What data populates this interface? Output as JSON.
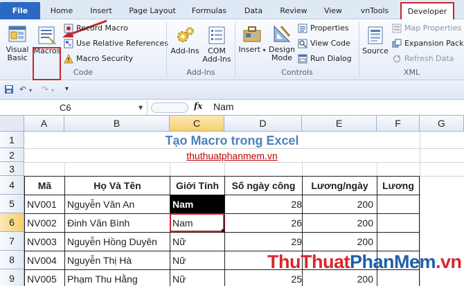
{
  "ribbon_tabs": {
    "file": "File",
    "home": "Home",
    "insert": "Insert",
    "page_layout": "Page Layout",
    "formulas": "Formulas",
    "data": "Data",
    "review": "Review",
    "view": "View",
    "vntools": "vnTools",
    "developer": "Developer"
  },
  "code_group": {
    "label": "Code",
    "visual_basic": [
      "Visual",
      "Basic"
    ],
    "macros": "Macros",
    "record_macro": "Record Macro",
    "use_relative": "Use Relative References",
    "macro_security": "Macro Security"
  },
  "addins_group": {
    "label": "Add-Ins",
    "addins": "Add-Ins",
    "com_addins": [
      "COM",
      "Add-Ins"
    ]
  },
  "controls_group": {
    "label": "Controls",
    "insert": "Insert",
    "design_mode": [
      "Design",
      "Mode"
    ],
    "properties": "Properties",
    "view_code": "View Code",
    "run_dialog": "Run Dialog"
  },
  "xml_group": {
    "label": "XML",
    "source": "Source",
    "map_properties": "Map Properties",
    "expansion_packs": "Expansion Packs",
    "refresh_data": "Refresh Data"
  },
  "formula_bar": {
    "name_box": "C6",
    "fx": "fx",
    "value": "Nam"
  },
  "columns": [
    "A",
    "B",
    "C",
    "D",
    "E",
    "F",
    "G"
  ],
  "rows": [
    "1",
    "2",
    "3",
    "4",
    "5",
    "6",
    "7",
    "8",
    "9"
  ],
  "sheet": {
    "title": "Tạo Macro trong Excel",
    "site": "thuthuatphanmem.vn",
    "headers": [
      "Mã",
      "Họ Và Tên",
      "Giới Tính",
      "Số ngày công",
      "Lương/ngày",
      "Lương"
    ],
    "data": [
      [
        "NV001",
        "Nguyễn Văn An",
        "Nam",
        "28",
        "200",
        ""
      ],
      [
        "NV002",
        "Đinh Văn Bình",
        "Nam",
        "26",
        "200",
        ""
      ],
      [
        "NV003",
        "Nguyễn Hồng Duyên",
        "Nữ",
        "29",
        "200",
        ""
      ],
      [
        "NV004",
        "Nguyễn Thị Hà",
        "Nữ",
        "",
        "",
        ""
      ],
      [
        "NV005",
        "Phạm Thu Hằng",
        "Nữ",
        "25",
        "200",
        ""
      ]
    ]
  },
  "watermark": {
    "part1": "ThuThuat",
    "part2": "PhanMem",
    "part3": ".vn"
  },
  "colors": {
    "accent": "#2a69c6",
    "highlight_border": "#c4262b",
    "title": "#4f81bd",
    "site_link": "#c00000"
  }
}
